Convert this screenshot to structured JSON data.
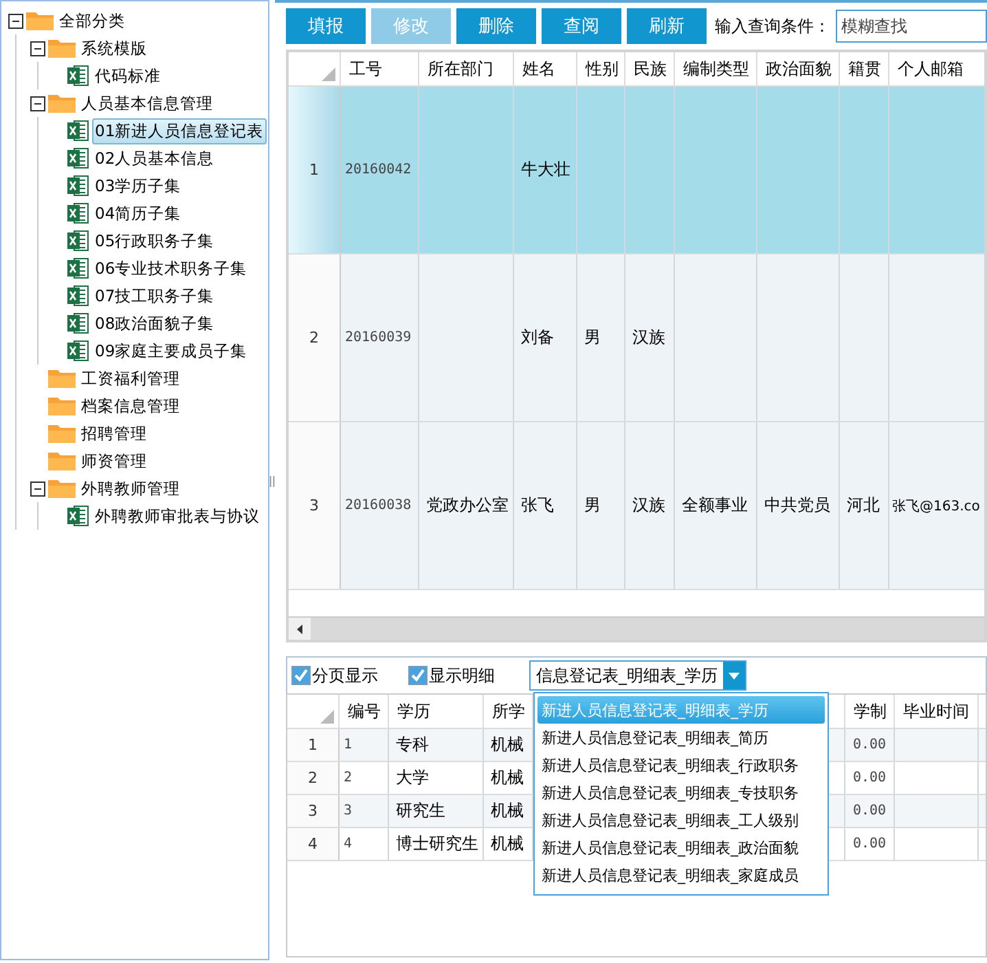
{
  "tree": [
    {
      "label": "全部分类",
      "kind": "folder",
      "expanded": true,
      "selected": false,
      "children": [
        {
          "label": "系统模版",
          "kind": "folder",
          "expanded": true,
          "selected": false,
          "children": [
            {
              "label": "代码标准",
              "kind": "sheet",
              "selected": false
            }
          ]
        },
        {
          "label": "人员基本信息管理",
          "kind": "folder",
          "expanded": true,
          "selected": false,
          "children": [
            {
              "label": "01新进人员信息登记表",
              "kind": "sheet",
              "selected": true
            },
            {
              "label": "02人员基本信息",
              "kind": "sheet",
              "selected": false
            },
            {
              "label": "03学历子集",
              "kind": "sheet",
              "selected": false
            },
            {
              "label": "04简历子集",
              "kind": "sheet",
              "selected": false
            },
            {
              "label": "05行政职务子集",
              "kind": "sheet",
              "selected": false
            },
            {
              "label": "06专业技术职务子集",
              "kind": "sheet",
              "selected": false
            },
            {
              "label": "07技工职务子集",
              "kind": "sheet",
              "selected": false
            },
            {
              "label": "08政治面貌子集",
              "kind": "sheet",
              "selected": false
            },
            {
              "label": "09家庭主要成员子集",
              "kind": "sheet",
              "selected": false
            }
          ]
        },
        {
          "label": "工资福利管理",
          "kind": "folder",
          "selected": false
        },
        {
          "label": "档案信息管理",
          "kind": "folder",
          "selected": false
        },
        {
          "label": "招聘管理",
          "kind": "folder",
          "selected": false
        },
        {
          "label": "师资管理",
          "kind": "folder",
          "selected": false
        },
        {
          "label": "外聘教师管理",
          "kind": "folder",
          "expanded": true,
          "selected": false,
          "children": [
            {
              "label": "外聘教师审批表与协议",
              "kind": "sheet",
              "selected": false
            }
          ]
        }
      ]
    }
  ],
  "toolbar": {
    "buttons": [
      {
        "label": "填报",
        "disabled": false
      },
      {
        "label": "修改",
        "disabled": true
      },
      {
        "label": "删除",
        "disabled": false
      },
      {
        "label": "查阅",
        "disabled": false
      },
      {
        "label": "刷新",
        "disabled": false
      }
    ],
    "search_label": "输入查询条件：",
    "search_placeholder": "模糊查找"
  },
  "main_table": {
    "columns": [
      "工号",
      "所在部门",
      "姓名",
      "性别",
      "民族",
      "编制类型",
      "政治面貌",
      "籍贯",
      "个人邮箱"
    ],
    "rows": [
      {
        "index": "1",
        "selected": true,
        "cells": [
          "20160042",
          "",
          "牛大壮",
          "",
          "",
          "",
          "",
          "",
          ""
        ]
      },
      {
        "index": "2",
        "selected": false,
        "cells": [
          "20160039",
          "",
          "刘备",
          "男",
          "汉族",
          "",
          "",
          "",
          ""
        ]
      },
      {
        "index": "3",
        "selected": false,
        "cells": [
          "20160038",
          "党政办公室",
          "张飞",
          "男",
          "汉族",
          "全额事业",
          "中共党员",
          "河北",
          "张飞@163.co"
        ]
      }
    ]
  },
  "detail_bar": {
    "paging": {
      "label": "分页显示",
      "checked": true
    },
    "show_detail": {
      "label": "显示明细",
      "checked": true
    },
    "select": {
      "value": "信息登记表_明细表_学历",
      "expanded": true,
      "options": [
        {
          "label": "新进人员信息登记表_明细表_学历",
          "selected": true
        },
        {
          "label": "新进人员信息登记表_明细表_简历",
          "selected": false
        },
        {
          "label": "新进人员信息登记表_明细表_行政职务",
          "selected": false
        },
        {
          "label": "新进人员信息登记表_明细表_专技职务",
          "selected": false
        },
        {
          "label": "新进人员信息登记表_明细表_工人级别",
          "selected": false
        },
        {
          "label": "新进人员信息登记表_明细表_政治面貌",
          "selected": false
        },
        {
          "label": "新进人员信息登记表_明细表_家庭成员",
          "selected": false
        }
      ]
    }
  },
  "detail_table": {
    "columns": [
      "编号",
      "学历",
      "所学",
      "",
      "学制",
      "毕业时间"
    ],
    "rows": [
      {
        "index": "1",
        "cells": [
          "1",
          "专科",
          "机械",
          "",
          "0.00",
          ""
        ]
      },
      {
        "index": "2",
        "cells": [
          "2",
          "大学",
          "机械",
          "",
          "0.00",
          ""
        ]
      },
      {
        "index": "3",
        "cells": [
          "3",
          "研究生",
          "机械",
          "",
          "0.00",
          ""
        ]
      },
      {
        "index": "4",
        "cells": [
          "4",
          "博士研究生",
          "机械",
          "",
          "0.00",
          ""
        ]
      }
    ]
  }
}
